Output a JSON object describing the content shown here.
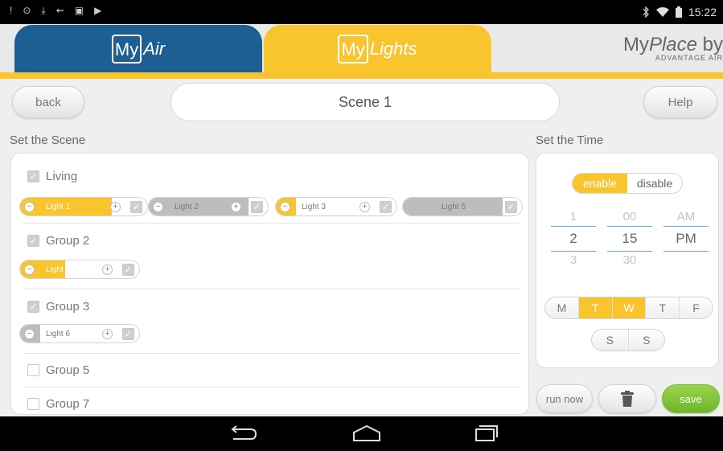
{
  "status_bar": {
    "left_icons": [
      "!",
      "⊙",
      "⤓",
      "⇜",
      "▣",
      "▶"
    ],
    "time": "15:22"
  },
  "header": {
    "tab_myair": {
      "box": "My",
      "word": "Air"
    },
    "tab_mylights": {
      "box": "My",
      "word": "Lights"
    },
    "brand_main_prefix": "My",
    "brand_main_italic": "Place",
    "brand_main_suffix": " by",
    "brand_sub": "ADVANTAGE AIR"
  },
  "toolbar": {
    "back_label": "back",
    "scene_name": "Scene 1",
    "help_label": "Help"
  },
  "scene": {
    "title": "Set the Scene",
    "groups": [
      {
        "name": "Living",
        "checked": true,
        "lights": [
          {
            "name": "Light 1",
            "level": 0.85,
            "checked": true
          },
          {
            "name": "Light 2",
            "level": 1.0,
            "checked": true
          },
          {
            "name": "Light 3",
            "level": 0.2,
            "checked": true
          },
          {
            "name": "Light 5",
            "level": 1.0,
            "checked": true
          }
        ]
      },
      {
        "name": "Group 2",
        "checked": true,
        "lights": [
          {
            "name": "Light 4",
            "level": 0.45,
            "checked": true
          }
        ]
      },
      {
        "name": "Group 3",
        "checked": true,
        "lights": [
          {
            "name": "Light 6",
            "level": 0.2,
            "checked": true
          }
        ]
      },
      {
        "name": "Group 5",
        "checked": false,
        "lights": []
      },
      {
        "name": "Group 7",
        "checked": false,
        "lights": []
      }
    ]
  },
  "time": {
    "title": "Set the Time",
    "enable_label": "enable",
    "disable_label": "disable",
    "hour": {
      "prev": "1",
      "selected": "2",
      "next": "3"
    },
    "minute": {
      "prev": "00",
      "selected": "15",
      "next": "30"
    },
    "ampm": {
      "prev": "AM",
      "selected": "PM",
      "next": ""
    },
    "days_row1": [
      {
        "label": "M",
        "on": false
      },
      {
        "label": "T",
        "on": true
      },
      {
        "label": "W",
        "on": true
      },
      {
        "label": "T",
        "on": false
      },
      {
        "label": "F",
        "on": false
      }
    ],
    "days_row2": [
      {
        "label": "S",
        "on": false
      },
      {
        "label": "S",
        "on": false
      }
    ]
  },
  "actions": {
    "run_now_label": "run now",
    "delete_icon": "trash-icon",
    "save_label": "save"
  },
  "colors": {
    "accent_yellow": "#f9c52f",
    "myair_blue": "#1e5f93",
    "save_green": "#7cc13a",
    "picker_blue": "#5ab2d9",
    "light_grey": "#bdbdbd"
  }
}
